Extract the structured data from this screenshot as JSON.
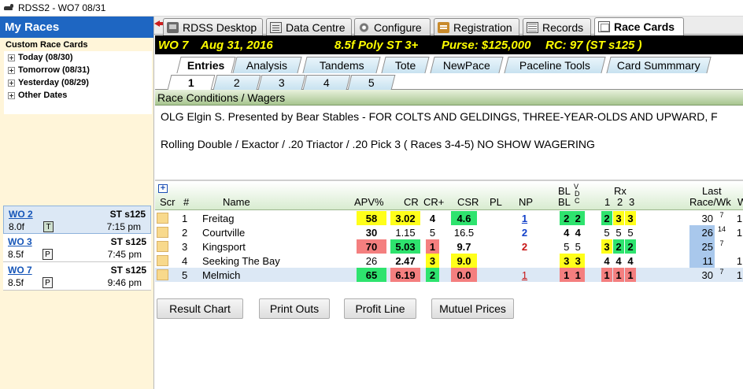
{
  "window": {
    "title": "RDSS2 - WO7  08/31"
  },
  "sidebar": {
    "header": "My Races",
    "custom_label": "Custom Race Cards",
    "tree": [
      {
        "label": "Today (08/30)"
      },
      {
        "label": "Tomorrow (08/31)"
      },
      {
        "label": "Yesterday (08/29)"
      },
      {
        "label": "Other Dates"
      }
    ],
    "races": [
      {
        "track": "WO  2",
        "cond": "ST s125",
        "dist": "8.0f",
        "badge": "T",
        "time": "7:15 pm",
        "selected": true
      },
      {
        "track": "WO  3",
        "cond": "ST s125",
        "dist": "8.5f",
        "badge": "P",
        "time": "7:45 pm",
        "selected": false
      },
      {
        "track": "WO  7",
        "cond": "ST s125",
        "dist": "8.5f",
        "badge": "P",
        "time": "9:46 pm",
        "selected": false
      }
    ]
  },
  "top_tabs": [
    {
      "label": "RDSS Desktop",
      "icon": "desktop-icon"
    },
    {
      "label": "Data Centre",
      "icon": "data-centre-icon"
    },
    {
      "label": "Configure",
      "icon": "gear-icon"
    },
    {
      "label": "Registration",
      "icon": "registration-icon"
    },
    {
      "label": "Records",
      "icon": "records-icon"
    },
    {
      "label": "Race Cards",
      "icon": "race-cards-icon",
      "active": true
    }
  ],
  "race_header": {
    "track_race": "WO  7",
    "date": "Aug 31, 2016",
    "dist_surface": "8.5f  Poly  ST  3+",
    "purse": "Purse: $125,000",
    "rc": "RC: 97  (ST s125 )"
  },
  "sub_tabs": [
    {
      "label": "Entries",
      "active": true
    },
    {
      "label": "Analysis"
    },
    {
      "label": "Tandems"
    },
    {
      "label": "Tote"
    },
    {
      "label": "NewPace"
    },
    {
      "label": "Paceline Tools"
    },
    {
      "label": "Card Summmary"
    }
  ],
  "num_tabs": [
    {
      "label": "1",
      "active": true
    },
    {
      "label": "2"
    },
    {
      "label": "3"
    },
    {
      "label": "4"
    },
    {
      "label": "5"
    }
  ],
  "conditions": {
    "header": "Race Conditions / Wagers",
    "line1": "OLG Elgin S. Presented by Bear Stables - FOR COLTS AND GELDINGS, THREE-YEAR-OLDS AND UPWARD, F",
    "line2": "Rolling Double / Exactor / .20 Triactor / .20 Pick 3 ( Races 3-4-5) NO SHOW WAGERING"
  },
  "table": {
    "headers": {
      "scr": "Scr",
      "pgm": "#",
      "name": "Name",
      "apv": "APV%",
      "cr": "CR",
      "crplus": "CR+",
      "csr": "CSR",
      "pl": "PL",
      "np": "NP",
      "bl_top": "BL",
      "bl_bot": "BL",
      "vdc_v": "V",
      "vdc_d": "D",
      "vdc_c": "C",
      "rx": "Rx",
      "rx_1": "1",
      "rx_2": "2",
      "rx_3": "3",
      "last": "Last",
      "racewk": "Race/Wk",
      "w": "W"
    },
    "rows": [
      {
        "pgm": "1",
        "name": "Freitag",
        "apv": "58",
        "cr": "3.02",
        "crplus": "4",
        "csr": "4.6",
        "np": "1",
        "bl1": "2",
        "bl2": "2",
        "rx1": "2",
        "rx2": "3",
        "rx3": "3",
        "race": "30",
        "wk": "7",
        "tail": "1"
      },
      {
        "pgm": "2",
        "name": "Courtville",
        "apv": "30",
        "cr": "1.15",
        "crplus": "5",
        "csr": "16.5",
        "np": "2",
        "bl1": "4",
        "bl2": "4",
        "rx1": "5",
        "rx2": "5",
        "rx3": "5",
        "race": "26",
        "wk": "14",
        "tail": "1"
      },
      {
        "pgm": "3",
        "name": "Kingsport",
        "apv": "70",
        "cr": "5.03",
        "crplus": "1",
        "csr": "9.7",
        "np": "2",
        "bl1": "5",
        "bl2": "5",
        "rx1": "3",
        "rx2": "2",
        "rx3": "2",
        "race": "25",
        "wk": "7",
        "tail": ""
      },
      {
        "pgm": "4",
        "name": "Seeking The Bay",
        "apv": "26",
        "cr": "2.47",
        "crplus": "3",
        "csr": "9.0",
        "np": "",
        "bl1": "3",
        "bl2": "3",
        "rx1": "4",
        "rx2": "4",
        "rx3": "4",
        "race": "11",
        "wk": "",
        "tail": "1"
      },
      {
        "pgm": "5",
        "name": "Melmich",
        "apv": "65",
        "cr": "6.19",
        "crplus": "2",
        "csr": "0.0",
        "np": "1",
        "bl1": "1",
        "bl2": "1",
        "rx1": "1",
        "rx2": "1",
        "rx3": "1",
        "race": "30",
        "wk": "7",
        "tail": "1"
      }
    ]
  },
  "buttons": {
    "result_chart": "Result Chart",
    "print_outs": "Print Outs",
    "profit_line": "Profit Line",
    "mutuel_prices": "Mutuel Prices"
  },
  "colors": {
    "green": "#2ee36e",
    "yellow": "#ffff1a",
    "red": "#f47f7f",
    "blue": "#a9c8ec",
    "header_bg": "#000000",
    "header_fg": "#ffff00"
  }
}
